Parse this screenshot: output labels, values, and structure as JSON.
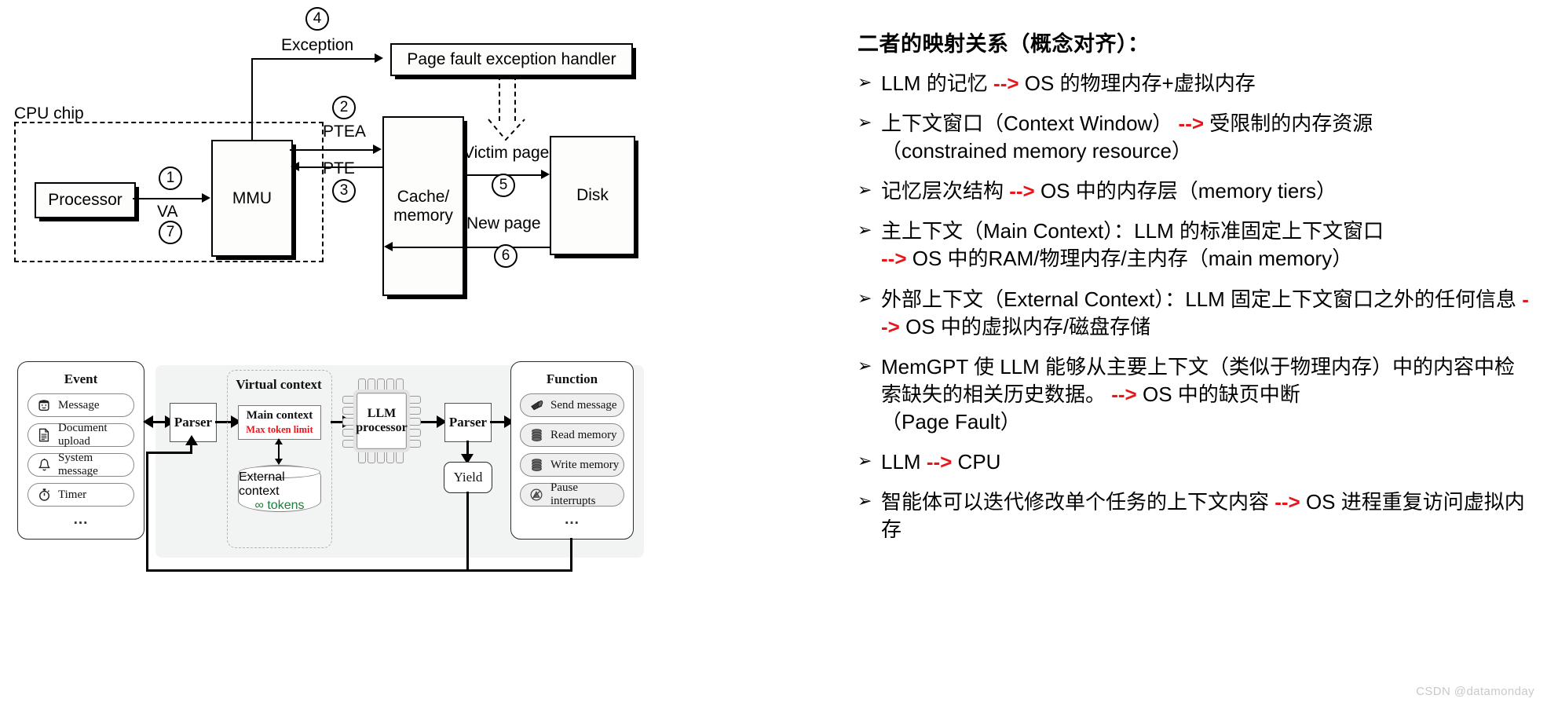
{
  "vm_diagram": {
    "name": "virtual-memory-page-fault-diagram",
    "cpu_chip_label": "CPU chip",
    "boxes": {
      "processor": "Processor",
      "mmu": "MMU",
      "cache_memory": "Cache/\nmemory",
      "disk": "Disk",
      "page_fault_handler": "Page fault exception handler"
    },
    "edge_labels": {
      "va": "VA",
      "ptea": "PTEA",
      "pte": "PTE",
      "exception": "Exception",
      "victim_page": "Victim page",
      "new_page": "New page"
    },
    "step_numbers": [
      "1",
      "2",
      "3",
      "4",
      "5",
      "6",
      "7"
    ]
  },
  "memgpt_diagram": {
    "name": "memgpt-architecture-diagram",
    "event_card": {
      "title": "Event",
      "items": [
        {
          "label": "Message",
          "icon": "user-face-icon"
        },
        {
          "label": "Document upload",
          "icon": "document-icon"
        },
        {
          "label": "System message",
          "icon": "bell-icon"
        },
        {
          "label": "Timer",
          "icon": "stopwatch-icon"
        }
      ],
      "more": "..."
    },
    "parser_in": "Parser",
    "parser_out": "Parser",
    "yield_box": "Yield",
    "virtual_context": {
      "title": "Virtual context",
      "main_context": {
        "title": "Main context",
        "subtitle": "Max token limit",
        "subtitle_color": "#e8161b"
      },
      "external_context": {
        "title": "External context",
        "subtitle": "∞ tokens",
        "subtitle_color": "#18803a"
      }
    },
    "llm_processor": "LLM\nprocessor",
    "function_card": {
      "title": "Function",
      "items": [
        {
          "label": "Send message",
          "icon": "megaphone-icon"
        },
        {
          "label": "Read memory",
          "icon": "database-icon"
        },
        {
          "label": "Write memory",
          "icon": "database-icon"
        },
        {
          "label": "Pause interrupts",
          "icon": "pause-interrupt-icon"
        }
      ],
      "more": "..."
    }
  },
  "text_pane": {
    "title": "二者的映射关系（概念对齐）：",
    "bullet_marker": "➢",
    "arrow_token": "-->",
    "arrow_color": "#e8161b",
    "bullets": [
      [
        {
          "t": "LLM 的记忆 "
        },
        {
          "t": "-->",
          "a": true
        },
        {
          "t": " OS 的物理内存+虚拟内存"
        }
      ],
      [
        {
          "t": "上下文窗口（Context Window）"
        },
        {
          "t": " --> ",
          "a": true
        },
        {
          "t": "受限制的内存资源\n（constrained memory resource）"
        }
      ],
      [
        {
          "t": "记忆层次结构 "
        },
        {
          "t": "-->",
          "a": true
        },
        {
          "t": " OS 中的内存层（memory tiers）"
        }
      ],
      [
        {
          "t": "主上下文（Main Context）：LLM 的标准固定上下文窗口\n"
        },
        {
          "t": "-->",
          "a": true
        },
        {
          "t": " OS 中的RAM/物理内存/主内存（main memory）"
        }
      ],
      [
        {
          "t": "外部上下文（External Context）：LLM 固定上下文窗口之外的任何信息 "
        },
        {
          "t": "-->",
          "a": true
        },
        {
          "t": " OS 中的虚拟内存/磁盘存储"
        }
      ],
      [
        {
          "t": "MemGPT 使 LLM 能够从主要上下文（类似于物理内存）中的内容中检索缺失的相关历史数据。"
        },
        {
          "t": " --> ",
          "a": true
        },
        {
          "t": "OS 中的缺页中断\n（Page Fault）"
        }
      ],
      [
        {
          "t": "LLM "
        },
        {
          "t": "-->",
          "a": true
        },
        {
          "t": " CPU"
        }
      ],
      [
        {
          "t": "智能体可以迭代修改单个任务的上下文内容 "
        },
        {
          "t": "-->",
          "a": true
        },
        {
          "t": " OS 进程重复访问虚拟内存"
        }
      ]
    ]
  },
  "watermark": "CSDN @datamonday"
}
